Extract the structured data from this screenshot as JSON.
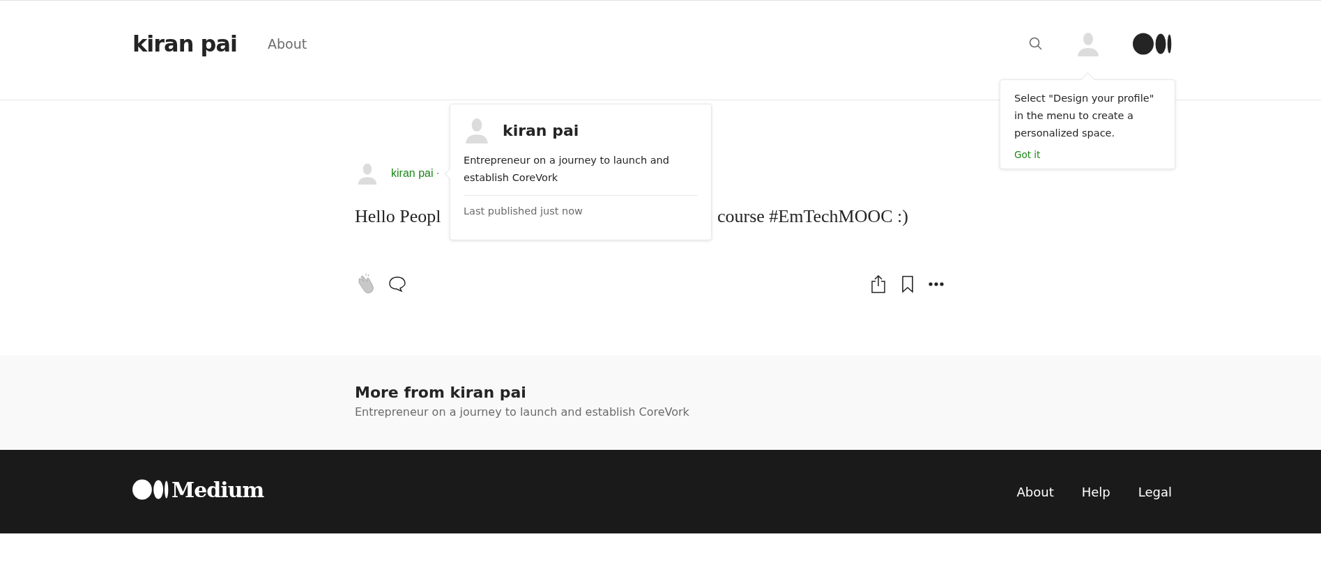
{
  "header": {
    "title": "kiran pai",
    "nav": [
      {
        "label": "About"
      }
    ]
  },
  "tooltip": {
    "text": "Select \"Design your profile\" in the menu to create a personalized space.",
    "action": "Got it"
  },
  "author_card": {
    "name": "kiran pai",
    "bio": "Entrepreneur on a journey to launch and establish CoreVork",
    "meta": "Last published just now"
  },
  "post": {
    "author": "kiran pai",
    "separator": "·",
    "text_visible": [
      "Hello Peopl",
      "course #EmTechMOOC :)"
    ]
  },
  "more_from": {
    "title": "More from kiran pai",
    "subtitle": "Entrepreneur on a journey to launch and establish CoreVork"
  },
  "footer": {
    "brand": "Medium",
    "links": [
      {
        "label": "About"
      },
      {
        "label": "Help"
      },
      {
        "label": "Legal"
      }
    ]
  }
}
